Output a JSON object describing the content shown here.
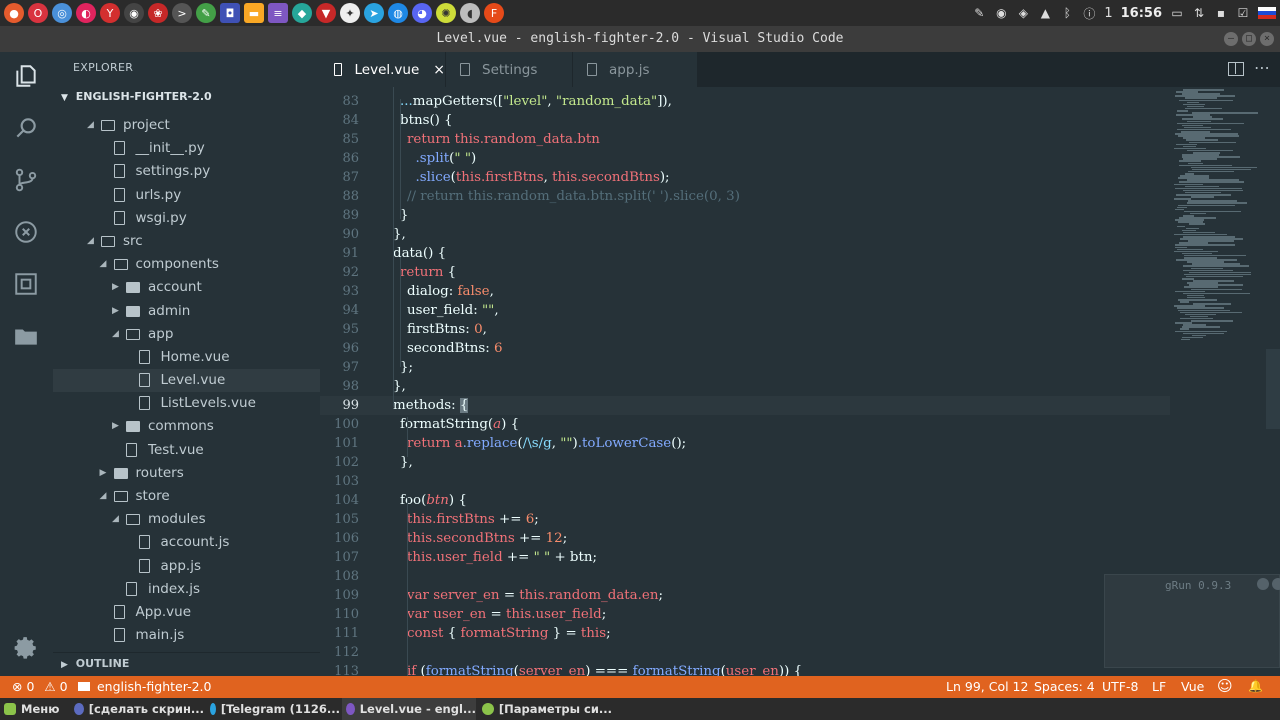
{
  "system_panel": {
    "launchers": [
      {
        "name": "firefox-icon",
        "color": "#e55b2d",
        "glyph": "●"
      },
      {
        "name": "opera-icon",
        "color": "#d9333f",
        "glyph": "O"
      },
      {
        "name": "chromium-icon",
        "color": "#4a90d9",
        "glyph": "◎"
      },
      {
        "name": "opera-alt-icon",
        "color": "#e0245e",
        "glyph": "◐"
      },
      {
        "name": "yandex-icon",
        "color": "#d32f2f",
        "glyph": "Y"
      },
      {
        "name": "camera-icon",
        "color": "#444444",
        "glyph": "◉"
      },
      {
        "name": "cherry-icon",
        "color": "#c62828",
        "glyph": "❀"
      },
      {
        "name": "terminal-icon",
        "color": "#555555",
        "glyph": ">"
      },
      {
        "name": "settings-icon",
        "color": "#43a047",
        "glyph": "✎"
      },
      {
        "name": "screenshot-icon",
        "color": "#3f51b5",
        "glyph": "◘"
      },
      {
        "name": "folder-icon",
        "color": "#f9a825",
        "glyph": "▬"
      },
      {
        "name": "notes-icon",
        "color": "#7e57c2",
        "glyph": "≡"
      },
      {
        "name": "color-picker-icon",
        "color": "#26a69a",
        "glyph": "◆"
      },
      {
        "name": "pin-icon",
        "color": "#c62828",
        "glyph": "▼"
      },
      {
        "name": "network-icon",
        "color": "#eeeeee",
        "glyph": "✦"
      },
      {
        "name": "telegram-icon",
        "color": "#2aa3e0",
        "glyph": "➤"
      },
      {
        "name": "globe-icon",
        "color": "#1e88e5",
        "glyph": "◍"
      },
      {
        "name": "discord-icon",
        "color": "#5865f2",
        "glyph": "◕"
      },
      {
        "name": "image-viewer-icon",
        "color": "#cddc39",
        "glyph": "✺"
      },
      {
        "name": "elephant-icon",
        "color": "#bdbdbd",
        "glyph": "◖"
      },
      {
        "name": "figma-icon",
        "color": "#e64a19",
        "glyph": "F"
      }
    ],
    "tray": {
      "battery_count": "1",
      "time": "16:56"
    }
  },
  "window": {
    "title": "Level.vue - english-fighter-2.0 - Visual Studio Code"
  },
  "sidebar": {
    "title": "EXPLORER",
    "folder": "ENGLISH-FIGHTER-2.0",
    "outline": "OUTLINE",
    "tree": [
      {
        "label": "project",
        "type": "folder",
        "open": true,
        "depth": 2
      },
      {
        "label": "__init__.py",
        "type": "file",
        "depth": 3
      },
      {
        "label": "settings.py",
        "type": "file",
        "depth": 3
      },
      {
        "label": "urls.py",
        "type": "file",
        "depth": 3
      },
      {
        "label": "wsgi.py",
        "type": "file",
        "depth": 3
      },
      {
        "label": "src",
        "type": "folder",
        "open": true,
        "depth": 2
      },
      {
        "label": "components",
        "type": "folder",
        "open": true,
        "depth": 3
      },
      {
        "label": "account",
        "type": "folder",
        "open": false,
        "depth": 4
      },
      {
        "label": "admin",
        "type": "folder",
        "open": false,
        "depth": 4
      },
      {
        "label": "app",
        "type": "folder",
        "open": true,
        "depth": 4
      },
      {
        "label": "Home.vue",
        "type": "file",
        "depth": 5
      },
      {
        "label": "Level.vue",
        "type": "file",
        "depth": 5,
        "selected": true
      },
      {
        "label": "ListLevels.vue",
        "type": "file",
        "depth": 5
      },
      {
        "label": "commons",
        "type": "folder",
        "open": false,
        "depth": 4
      },
      {
        "label": "Test.vue",
        "type": "file",
        "depth": 4
      },
      {
        "label": "routers",
        "type": "folder",
        "open": false,
        "depth": 3
      },
      {
        "label": "store",
        "type": "folder",
        "open": true,
        "depth": 3
      },
      {
        "label": "modules",
        "type": "folder",
        "open": true,
        "depth": 4
      },
      {
        "label": "account.js",
        "type": "file",
        "depth": 5
      },
      {
        "label": "app.js",
        "type": "file",
        "depth": 5
      },
      {
        "label": "index.js",
        "type": "file",
        "depth": 4
      },
      {
        "label": "App.vue",
        "type": "file",
        "depth": 3
      },
      {
        "label": "main.js",
        "type": "file",
        "depth": 3
      }
    ]
  },
  "tabs": [
    {
      "label": "Level.vue",
      "active": true,
      "close": "×"
    },
    {
      "label": "Settings",
      "active": false
    },
    {
      "label": "app.js",
      "active": false
    }
  ],
  "editor": {
    "current_line": 99,
    "lines": [
      {
        "n": "83",
        "tokens": [
          [
            "punc",
            "..."
          ],
          [
            "ident",
            "mapGetters(["
          ],
          [
            "str",
            "\"level\""
          ],
          [
            "ident",
            ", "
          ],
          [
            "str",
            "\"random_data\""
          ],
          [
            "ident",
            "]),"
          ]
        ],
        "indent": 1
      },
      {
        "n": "84",
        "tokens": [
          [
            "ident",
            "btns() {"
          ]
        ],
        "indent": 1
      },
      {
        "n": "85",
        "tokens": [
          [
            "kw",
            "return "
          ],
          [
            "prop",
            "this.random_data.btn"
          ]
        ],
        "indent": 2
      },
      {
        "n": "86",
        "tokens": [
          [
            "fn",
            "  .split"
          ],
          [
            "ident",
            "("
          ],
          [
            "str",
            "\" \""
          ],
          [
            "ident",
            ")"
          ]
        ],
        "indent": 2
      },
      {
        "n": "87",
        "tokens": [
          [
            "fn",
            "  .slice"
          ],
          [
            "ident",
            "("
          ],
          [
            "prop",
            "this.firstBtns"
          ],
          [
            "ident",
            ", "
          ],
          [
            "prop",
            "this.secondBtns"
          ],
          [
            "ident",
            ");"
          ]
        ],
        "indent": 2
      },
      {
        "n": "88",
        "tokens": [
          [
            "cmt",
            "// return this.random_data.btn.split(' ').slice(0, 3)"
          ]
        ],
        "indent": 2
      },
      {
        "n": "89",
        "tokens": [
          [
            "ident",
            "}"
          ]
        ],
        "indent": 1
      },
      {
        "n": "90",
        "tokens": [
          [
            "ident",
            "},"
          ]
        ],
        "indent": 0
      },
      {
        "n": "91",
        "tokens": [
          [
            "ident",
            "data() {"
          ]
        ],
        "indent": 0
      },
      {
        "n": "92",
        "tokens": [
          [
            "kw",
            "return "
          ],
          [
            "ident",
            "{"
          ]
        ],
        "indent": 1
      },
      {
        "n": "93",
        "tokens": [
          [
            "ident",
            "dialog: "
          ],
          [
            "bool",
            "false"
          ],
          [
            "ident",
            ","
          ]
        ],
        "indent": 2
      },
      {
        "n": "94",
        "tokens": [
          [
            "ident",
            "user_field: "
          ],
          [
            "str",
            "\"\""
          ],
          [
            "ident",
            ","
          ]
        ],
        "indent": 2
      },
      {
        "n": "95",
        "tokens": [
          [
            "ident",
            "firstBtns: "
          ],
          [
            "num",
            "0"
          ],
          [
            "ident",
            ","
          ]
        ],
        "indent": 2
      },
      {
        "n": "96",
        "tokens": [
          [
            "ident",
            "secondBtns: "
          ],
          [
            "num",
            "6"
          ]
        ],
        "indent": 2
      },
      {
        "n": "97",
        "tokens": [
          [
            "ident",
            "};"
          ]
        ],
        "indent": 1
      },
      {
        "n": "98",
        "tokens": [
          [
            "ident",
            "},"
          ]
        ],
        "indent": 0
      },
      {
        "n": "99",
        "tokens": [
          [
            "ident",
            "methods: "
          ],
          [
            "cursor",
            "{"
          ]
        ],
        "indent": 0
      },
      {
        "n": "100",
        "tokens": [
          [
            "ident",
            "formatString("
          ],
          [
            "par",
            "a"
          ],
          [
            "ident",
            ") {"
          ]
        ],
        "indent": 1
      },
      {
        "n": "101",
        "tokens": [
          [
            "kw",
            "return "
          ],
          [
            "prop",
            "a"
          ],
          [
            "fn",
            ".replace"
          ],
          [
            "ident",
            "("
          ],
          [
            "rx",
            "/\\s/g"
          ],
          [
            "ident",
            ", "
          ],
          [
            "str",
            "\"\""
          ],
          [
            "ident",
            ")"
          ],
          [
            "fn",
            ".toLowerCase"
          ],
          [
            "ident",
            "();"
          ]
        ],
        "indent": 2
      },
      {
        "n": "102",
        "tokens": [
          [
            "ident",
            "},"
          ]
        ],
        "indent": 1
      },
      {
        "n": "103",
        "tokens": [],
        "indent": 0
      },
      {
        "n": "104",
        "tokens": [
          [
            "ident",
            "foo("
          ],
          [
            "par",
            "btn"
          ],
          [
            "ident",
            ") {"
          ]
        ],
        "indent": 1
      },
      {
        "n": "105",
        "tokens": [
          [
            "prop",
            "this.firstBtns"
          ],
          [
            "ident",
            " += "
          ],
          [
            "num",
            "6"
          ],
          [
            "ident",
            ";"
          ]
        ],
        "indent": 2
      },
      {
        "n": "106",
        "tokens": [
          [
            "prop",
            "this.secondBtns"
          ],
          [
            "ident",
            " += "
          ],
          [
            "num",
            "12"
          ],
          [
            "ident",
            ";"
          ]
        ],
        "indent": 2
      },
      {
        "n": "107",
        "tokens": [
          [
            "prop",
            "this.user_field"
          ],
          [
            "ident",
            " += "
          ],
          [
            "str",
            "\" \""
          ],
          [
            "ident",
            " + btn;"
          ]
        ],
        "indent": 2
      },
      {
        "n": "108",
        "tokens": [],
        "indent": 0
      },
      {
        "n": "109",
        "tokens": [
          [
            "kw",
            "var "
          ],
          [
            "prop",
            "server_en"
          ],
          [
            "ident",
            " = "
          ],
          [
            "prop",
            "this.random_data.en"
          ],
          [
            "ident",
            ";"
          ]
        ],
        "indent": 2
      },
      {
        "n": "110",
        "tokens": [
          [
            "kw",
            "var "
          ],
          [
            "prop",
            "user_en"
          ],
          [
            "ident",
            " = "
          ],
          [
            "prop",
            "this.user_field"
          ],
          [
            "ident",
            ";"
          ]
        ],
        "indent": 2
      },
      {
        "n": "111",
        "tokens": [
          [
            "kw",
            "const "
          ],
          [
            "ident",
            "{ "
          ],
          [
            "prop",
            "formatString"
          ],
          [
            "ident",
            " } = "
          ],
          [
            "prop",
            "this"
          ],
          [
            "ident",
            ";"
          ]
        ],
        "indent": 2
      },
      {
        "n": "112",
        "tokens": [],
        "indent": 0
      },
      {
        "n": "113",
        "tokens": [
          [
            "kw",
            "if "
          ],
          [
            "ident",
            "("
          ],
          [
            "fn",
            "formatString"
          ],
          [
            "ident",
            "("
          ],
          [
            "prop",
            "server_en"
          ],
          [
            "ident",
            ") === "
          ],
          [
            "fn",
            "formatString"
          ],
          [
            "ident",
            "("
          ],
          [
            "prop",
            "user_en"
          ],
          [
            "ident",
            ")) {"
          ]
        ],
        "indent": 2
      }
    ]
  },
  "grun": {
    "title": "gRun 0.9.3"
  },
  "statusbar": {
    "errors": "0",
    "warnings": "0",
    "folder": "english-fighter-2.0",
    "position": "Ln 99, Col 12",
    "spaces": "Spaces: 4",
    "encoding": "UTF-8",
    "eol": "LF",
    "language": "Vue",
    "error_glyph": "⊗",
    "warning_glyph": "⚠",
    "smiley_glyph": "☺",
    "bell_glyph": "🔔"
  },
  "taskbar": {
    "menu": "Меню",
    "items": [
      {
        "label": "[сделать скрин...",
        "dot": "#5c6bc0"
      },
      {
        "label": "[Telegram (1126...",
        "dot": "#2aa3e0"
      },
      {
        "label": "Level.vue - engl...",
        "dot": "#7e57c2",
        "active": true
      },
      {
        "label": "[Параметры си...",
        "dot": "#8bc34a"
      }
    ]
  }
}
